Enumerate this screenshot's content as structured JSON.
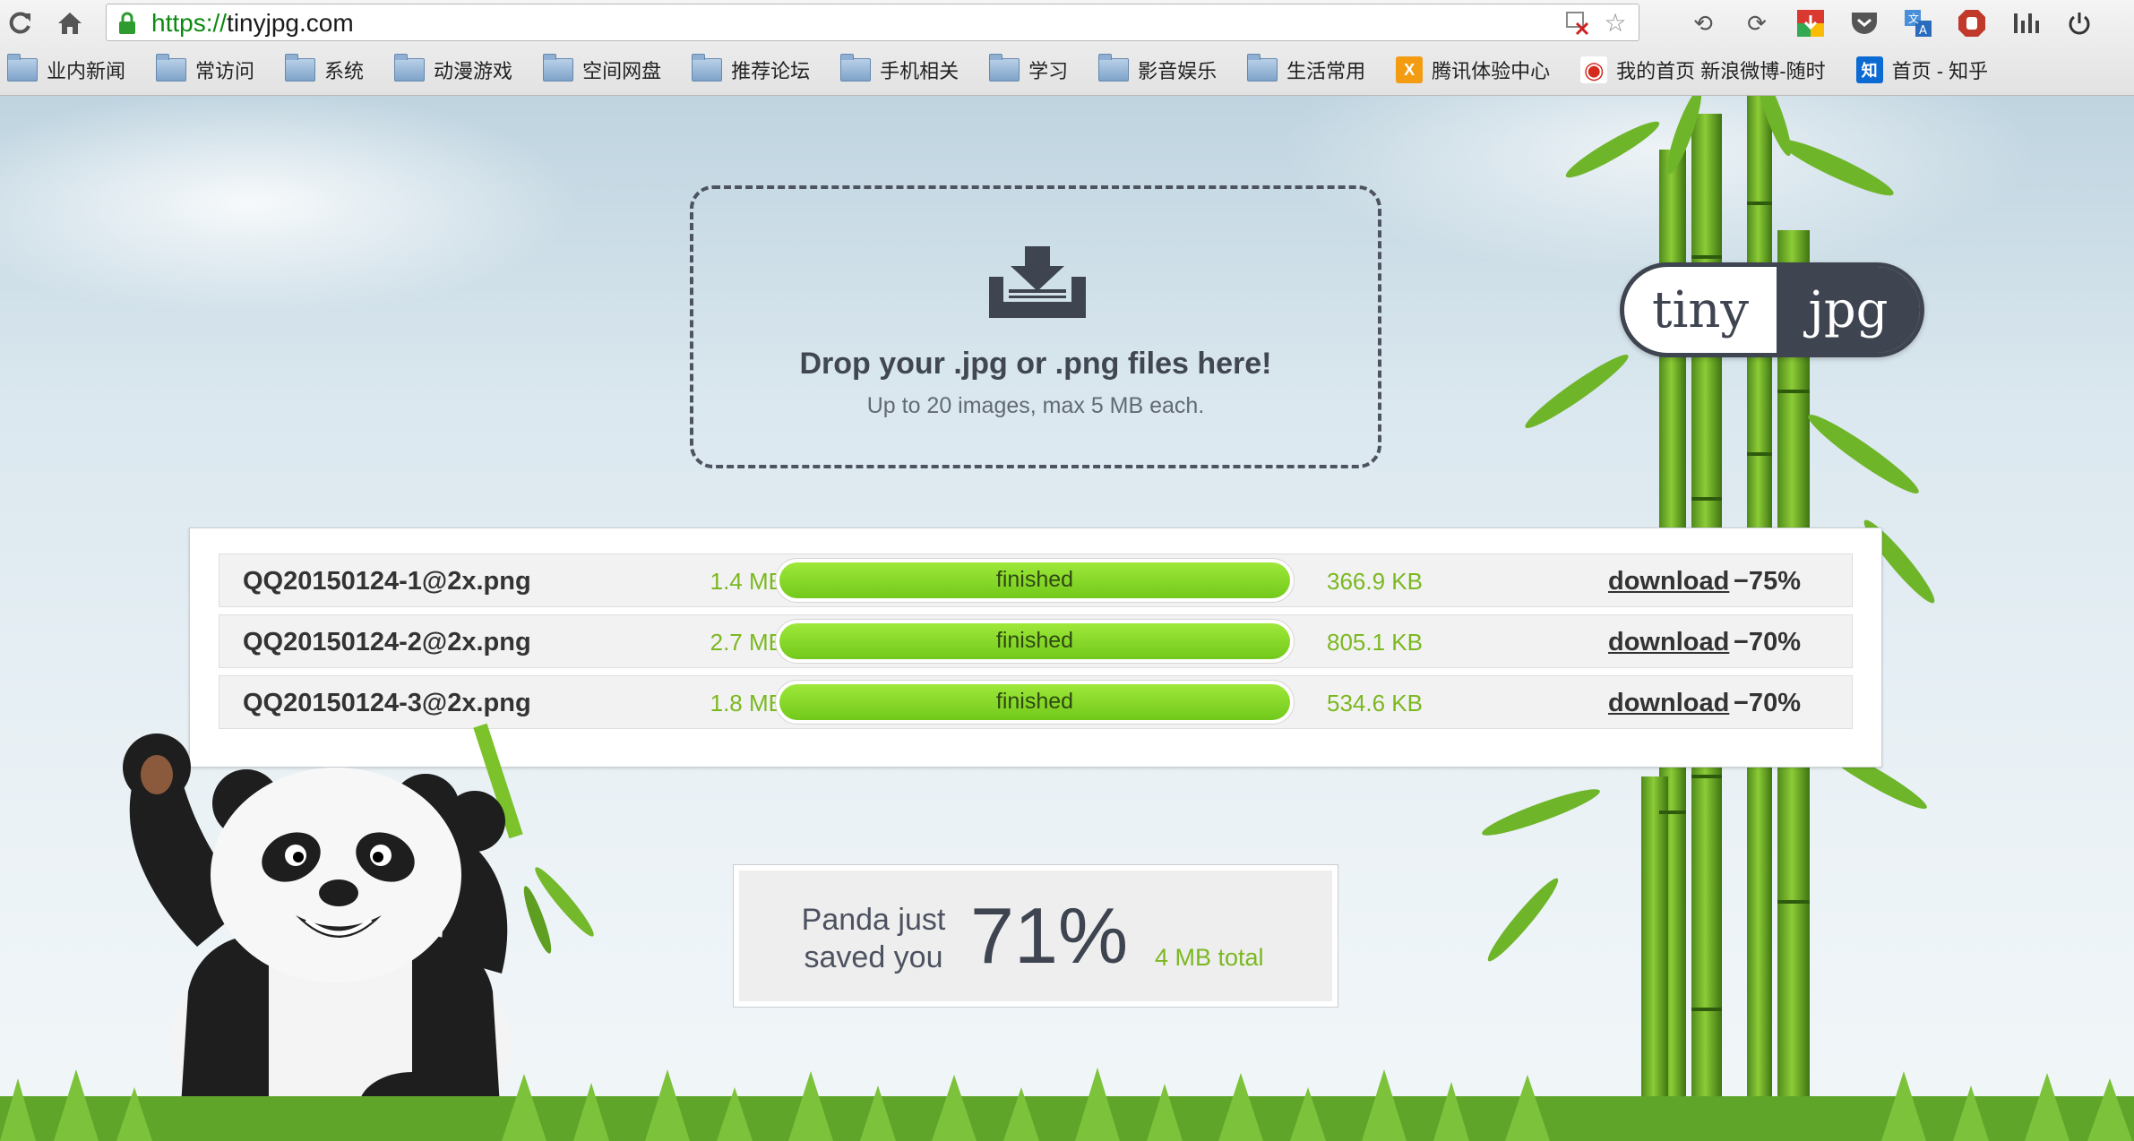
{
  "browser": {
    "url_scheme": "https://",
    "url_host": "tinyjpg.com",
    "bookmarks": [
      {
        "label": "业内新闻",
        "type": "folder"
      },
      {
        "label": "常访问",
        "type": "folder"
      },
      {
        "label": "系统",
        "type": "folder"
      },
      {
        "label": "动漫游戏",
        "type": "folder"
      },
      {
        "label": "空间网盘",
        "type": "folder"
      },
      {
        "label": "推荐论坛",
        "type": "folder"
      },
      {
        "label": "手机相关",
        "type": "folder"
      },
      {
        "label": "学习",
        "type": "folder"
      },
      {
        "label": "影音娱乐",
        "type": "folder"
      },
      {
        "label": "生活常用",
        "type": "folder"
      },
      {
        "label": "腾讯体验中心",
        "type": "site"
      },
      {
        "label": "我的首页 新浪微博-随时",
        "type": "site"
      },
      {
        "label": "首页 - 知乎",
        "type": "site"
      }
    ]
  },
  "dropzone": {
    "title": "Drop your .jpg or .png files here!",
    "subtitle": "Up to 20 images, max 5 MB each."
  },
  "logo": {
    "left": "tiny",
    "right": "jpg"
  },
  "files": [
    {
      "name": "QQ20150124-1@2x.png",
      "original_size": "1.4 MB",
      "status": "finished",
      "progress": 1.0,
      "new_size": "366.9 KB",
      "action": "download",
      "saving": "−75%"
    },
    {
      "name": "QQ20150124-2@2x.png",
      "original_size": "2.7 MB",
      "status": "finished",
      "progress": 1.0,
      "new_size": "805.1 KB",
      "action": "download",
      "saving": "−70%"
    },
    {
      "name": "QQ20150124-3@2x.png",
      "original_size": "1.8 MB",
      "status": "finished",
      "progress": 1.0,
      "new_size": "534.6 KB",
      "action": "download",
      "saving": "−70%"
    }
  ],
  "summary": {
    "label_line1": "Panda just",
    "label_line2": "saved you",
    "percent": "71%",
    "total": "4 MB total"
  },
  "colors": {
    "accent_green": "#7bb820",
    "progress_green": "#84d628",
    "dark_slate": "#3e4450"
  }
}
